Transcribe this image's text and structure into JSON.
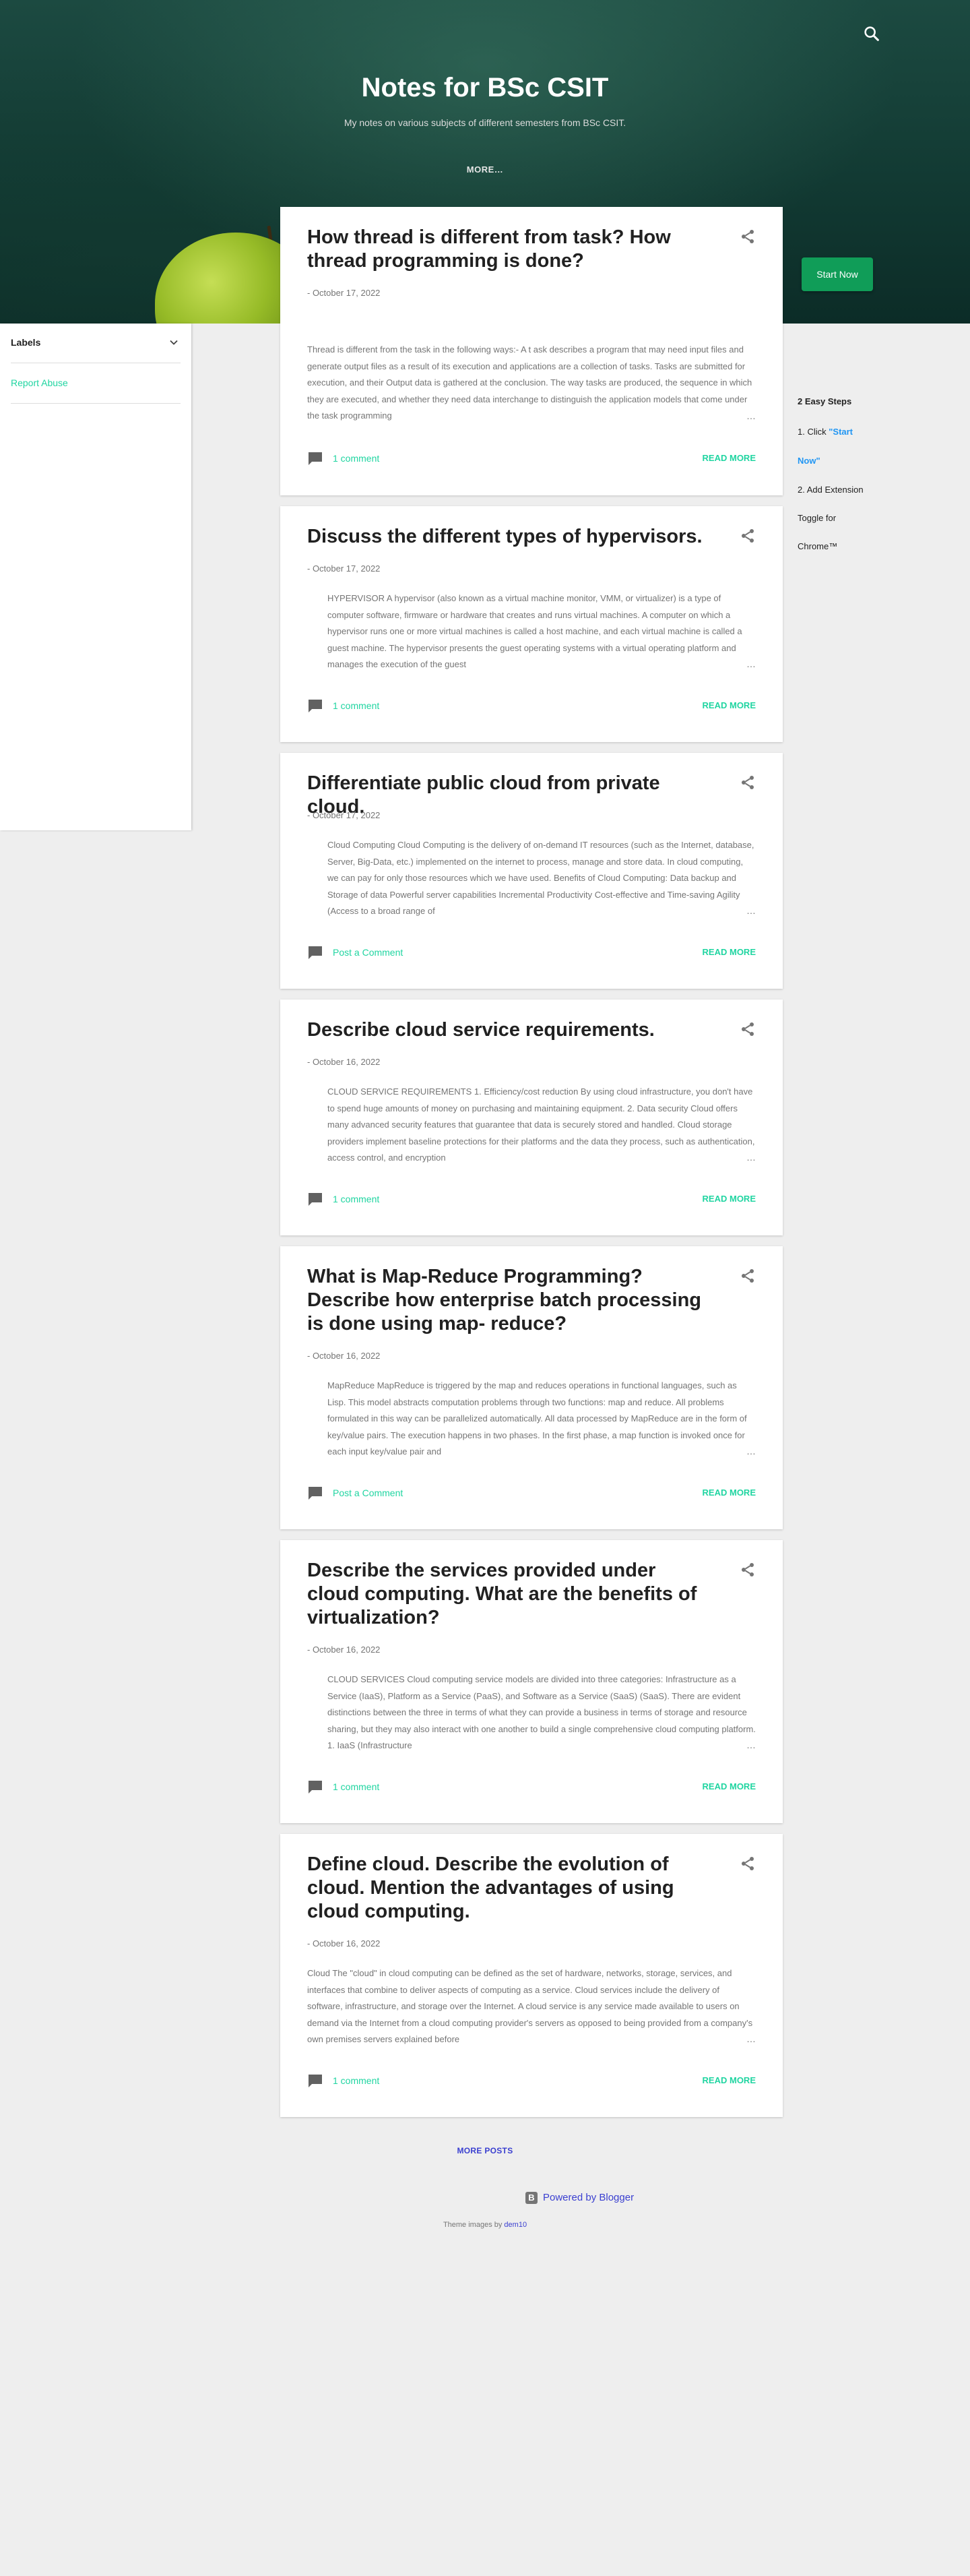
{
  "header": {
    "title": "Notes for BSc CSIT",
    "description": "My notes on various subjects of different semesters from BSc CSIT.",
    "more_label": "MORE…",
    "start_now_label": "Start Now"
  },
  "sidebar": {
    "labels_heading": "Labels",
    "report_abuse": "Report Abuse"
  },
  "widget": {
    "title": "2 Easy Steps",
    "step1_prefix": "1. Click ",
    "step1_link_line1": "\"Start",
    "step1_link_line2": "Now\"",
    "step2_line1": "2. Add Extension",
    "step2_line2": "Toggle for",
    "step2_line3": "Chrome™"
  },
  "posts": [
    {
      "title": "How thread is different from task? How thread programming is done?",
      "date": "- October 17, 2022",
      "snippet": "Thread is different from the task in the following ways:- A t ask  describes a program that may need input files and generate output files as a result of its execution and applications are a collection of tasks. Tasks are submitted for execution, and their Output data is gathered at the conclusion. The way tasks are produced, the sequence in which they are executed, and whether they need data interchange to distinguish the application models that come under the task programming",
      "comments": "1 comment",
      "read_more": "READ MORE"
    },
    {
      "title": "Discuss the different types of hypervisors.",
      "date": "- October 17, 2022",
      "snippet": "HYPERVISOR A hypervisor (also known as a virtual machine monitor, VMM, or virtualizer) is a type of computer software, firmware or hardware that creates and runs virtual machines. A computer on which a hypervisor runs one or more virtual machines is called a host machine, and each virtual machine is called a guest machine. The hypervisor presents the guest operating systems with a virtual operating platform and manages the execution of the guest",
      "comments": "1 comment",
      "read_more": "READ MORE"
    },
    {
      "title": "Differentiate public cloud from private cloud.",
      "date": "- October 17, 2022",
      "snippet": "Cloud Computing Cloud Computing is the delivery of on-demand IT resources (such as the Internet, database, Server, Big-Data, etc.) implemented on the internet to process, manage and store data. In cloud computing, we can pay for only those resources which we have used. Benefits of Cloud Computing: Data backup and Storage of data Powerful server capabilities Incremental Productivity Cost-effective and Time-saving Agility (Access to a broad range of",
      "comments": "Post a Comment",
      "read_more": "READ MORE"
    },
    {
      "title": "Describe cloud service requirements.",
      "date": "- October 16, 2022",
      "snippet": "CLOUD SERVICE REQUIREMENTS 1. Efficiency/cost reduction By using cloud infrastructure, you don't have to spend huge amounts of money on purchasing and maintaining equipment. 2. Data security Cloud offers many advanced security features that guarantee that data is securely stored and handled. Cloud storage providers implement baseline protections for their platforms and the data they process, such as authentication, access control, and encryption",
      "comments": "1 comment",
      "read_more": "READ MORE"
    },
    {
      "title": "What is Map-Reduce Programming? Describe how enterprise batch processing is done using map- reduce?",
      "date": "- October 16, 2022",
      "snippet": "MapReduce  MapReduce is triggered by the map and reduces operations in functional languages, such as Lisp. This model abstracts computation problems through two functions: map and reduce. All problems formulated in this way can be parallelized automatically. All data processed by MapReduce are in the form of key/value pairs. The execution happens in two phases. In the first phase, a map function is invoked once for each input key/value pair and",
      "comments": "Post a Comment",
      "read_more": "READ MORE"
    },
    {
      "title": "Describe the services provided under cloud computing. What are the benefits of virtualization?",
      "date": "- October 16, 2022",
      "snippet": "CLOUD SERVICES Cloud computing service models are divided into three categories: Infrastructure as a Service (IaaS), Platform as a Service (PaaS), and Software as a Service (SaaS) (SaaS). There are evident distinctions between the three in terms of what they can provide a business in terms of storage and resource sharing, but they may also interact with one another to build a single comprehensive cloud computing platform. 1. IaaS (Infrastructure",
      "comments": "1 comment",
      "read_more": "READ MORE"
    },
    {
      "title": "Define cloud. Describe the evolution of cloud. Mention the advantages of using cloud computing.",
      "date": "- October 16, 2022",
      "snippet": "Cloud The \"cloud\" in cloud computing can be defined as the set of hardware, networks, storage, services, and interfaces that combine to deliver aspects of computing as a service. Cloud services include the delivery of software, infrastructure, and storage over the Internet. A cloud service is any service made available to users on demand via the Internet from a cloud computing provider's servers as opposed to being provided from a company's own premises servers explained before",
      "comments": "1 comment",
      "read_more": "READ MORE"
    }
  ],
  "footer": {
    "more_posts": "MORE POSTS",
    "powered_by": "Powered by Blogger",
    "theme_images_prefix": "Theme images by ",
    "theme_images_author": "dem10"
  },
  "colors": {
    "accent": "#20d5a1",
    "start_button": "#109d58",
    "link_blue": "#3a3fd0",
    "header_bg": "#1c4a41"
  }
}
